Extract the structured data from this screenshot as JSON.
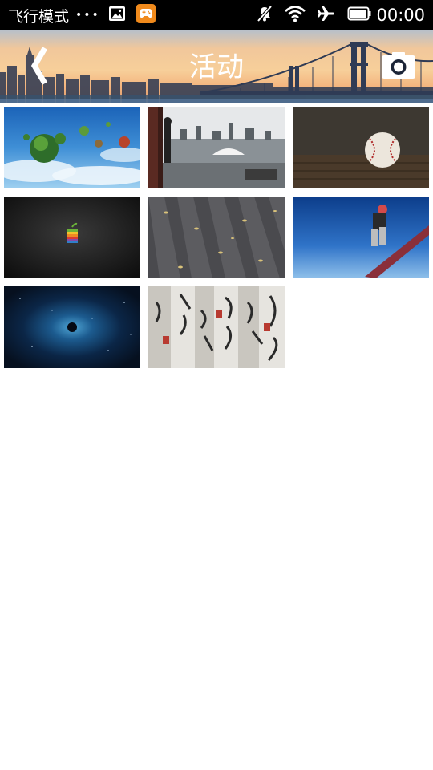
{
  "status_bar": {
    "mode_text": "飞行模式",
    "dots": "•••",
    "time": "00:00",
    "icons": [
      "image-icon",
      "game-icon",
      "mute-icon",
      "wifi-icon",
      "airplane-icon",
      "battery-icon"
    ]
  },
  "header": {
    "title": "活动",
    "back_icon": "back-chevron-icon",
    "camera_icon": "camera-icon"
  },
  "gallery": {
    "items": [
      {
        "name": "floating-islands"
      },
      {
        "name": "city-window-view"
      },
      {
        "name": "baseball"
      },
      {
        "name": "apple-dark"
      },
      {
        "name": "wooden-deck-leaves"
      },
      {
        "name": "snowboarder-sky"
      },
      {
        "name": "space-galaxy"
      },
      {
        "name": "chinese-calligraphy"
      }
    ]
  },
  "colors": {
    "status_bar_bg": "#000000",
    "page_bg": "#ffffff",
    "title_color": "#ffffff"
  }
}
